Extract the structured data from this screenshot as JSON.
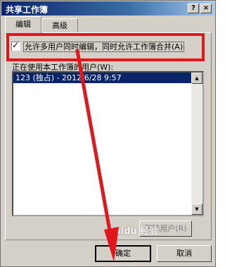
{
  "window": {
    "title": "共享工作簿",
    "help_label": "?",
    "close_label": "×"
  },
  "tabs": [
    {
      "label": "编辑"
    },
    {
      "label": "高级"
    }
  ],
  "checkbox": {
    "label": "允许多用户同时编辑，同时允许工作簿合并",
    "accelerator": "(A)",
    "checked": true,
    "mark": "✓"
  },
  "users": {
    "label": "正在使用本工作簿的用户(W):",
    "rows": [
      "123 (独占) - 2012/6/28 9:57"
    ]
  },
  "buttons": {
    "remove": "删除用户(R)",
    "ok": "确定",
    "cancel": "取消"
  },
  "watermark": "Baidu 经验",
  "colors": {
    "annotation_red": "#e3161c",
    "title_bar": "#0a246a",
    "selection": "#0a246a"
  }
}
